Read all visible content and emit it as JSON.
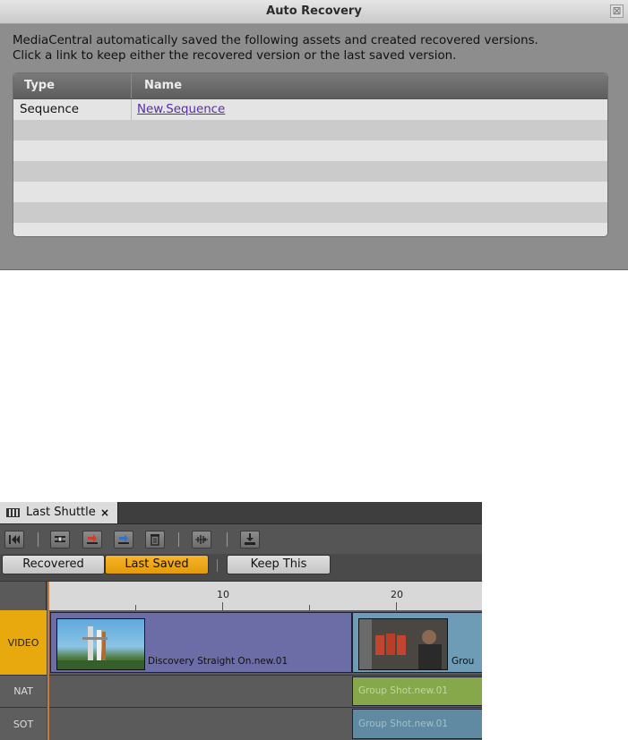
{
  "dialog": {
    "title": "Auto Recovery",
    "close_glyph": "⊠",
    "message_line1": "MediaCentral automatically saved the following assets and created recovered versions.",
    "message_line2": "Click a link to keep either the recovered version or the last saved version.",
    "table": {
      "headers": {
        "type": "Type",
        "name": "Name"
      },
      "rows": [
        {
          "type": "Sequence",
          "name": "New.Sequence"
        },
        {
          "type": "",
          "name": ""
        },
        {
          "type": "",
          "name": ""
        },
        {
          "type": "",
          "name": ""
        },
        {
          "type": "",
          "name": ""
        },
        {
          "type": "",
          "name": ""
        }
      ]
    }
  },
  "panel": {
    "tab": {
      "label": "Last Shuttle",
      "close_glyph": "×",
      "icon": "filmstrip-icon"
    },
    "toolbar": {
      "icons": [
        "go-to-start-icon",
        "lift-icon",
        "overwrite-red-icon",
        "splice-blue-icon",
        "delete-icon",
        "audio-waveform-icon",
        "download-icon"
      ]
    },
    "modes": {
      "recovered": "Recovered",
      "last_saved": "Last Saved",
      "keep_this": "Keep This",
      "active": "last_saved"
    },
    "ruler": {
      "label_10": "10",
      "label_20": "20"
    },
    "tracks": {
      "video": "VIDEO",
      "nat": "NAT",
      "sot": "SOT"
    },
    "clips": {
      "video1": "Discovery Straight On.new.01",
      "video2": "Grou",
      "nat": "Group Shot.new.01",
      "sot": "Group Shot.new.01"
    },
    "colors": {
      "active_mode": "#e8a90e",
      "video_clip1": "#6c6ca6",
      "video_clip2": "#6e9bb6",
      "nat_clip": "#87a84a",
      "sot_clip": "#5f8aa2"
    }
  }
}
